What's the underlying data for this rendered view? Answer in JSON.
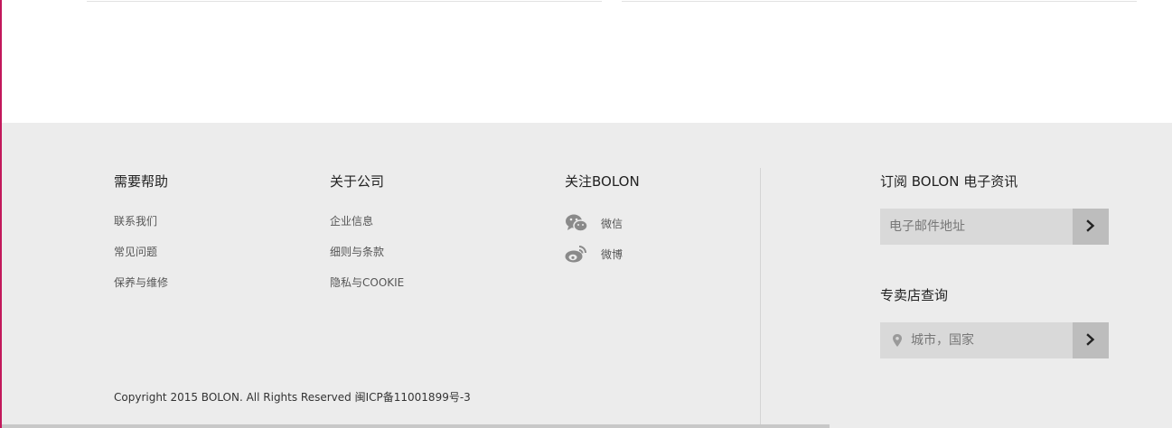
{
  "help": {
    "title": "需要帮助",
    "links": [
      "联系我们",
      "常见问题",
      "保养与维修"
    ]
  },
  "about": {
    "title": "关于公司",
    "links": [
      "企业信息",
      "细则与条款",
      "隐私与COOKIE"
    ]
  },
  "follow": {
    "title": "关注BOLON",
    "items": [
      {
        "label": "微信",
        "icon": "wechat-icon"
      },
      {
        "label": "微博",
        "icon": "weibo-icon"
      }
    ]
  },
  "subscribe": {
    "title": "订阅 BOLON 电子资讯",
    "placeholder": "电子邮件地址",
    "button_icon": "chevron-right-icon"
  },
  "store": {
    "title": "专卖店查询",
    "placeholder": "城市，国家",
    "pin_icon": "location-pin-icon",
    "button_icon": "chevron-right-icon"
  },
  "copyright": "Copyright 2015 BOLON. All Rights Reserved 闽ICP备11001899号-3",
  "colors": {
    "footer_bg": "#ececec",
    "input_bg": "#d9d9d9",
    "button_bg": "#bdbdbd",
    "accent": "#c2185b"
  }
}
